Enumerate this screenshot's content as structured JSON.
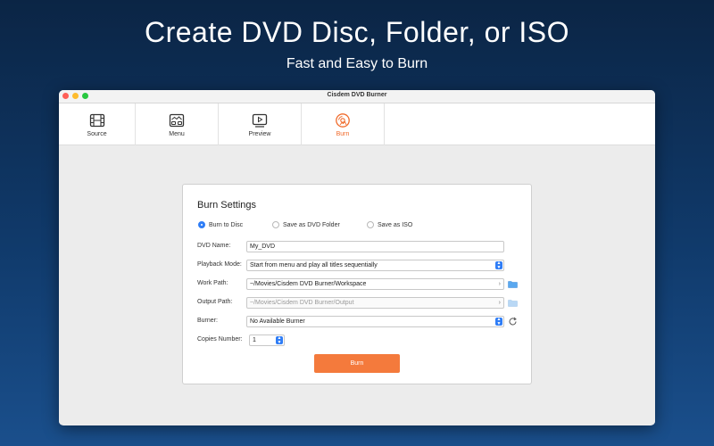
{
  "hero": {
    "title": "Create DVD Disc, Folder, or ISO",
    "subtitle": "Fast and Easy to Burn"
  },
  "window": {
    "title": "Cisdem DVD Burner"
  },
  "toolbar": {
    "tabs": [
      {
        "label": "Source",
        "icon": "film-icon",
        "active": false
      },
      {
        "label": "Menu",
        "icon": "menu-layout-icon",
        "active": false
      },
      {
        "label": "Preview",
        "icon": "play-icon",
        "active": false
      },
      {
        "label": "Burn",
        "icon": "disc-icon",
        "active": true
      }
    ]
  },
  "burn_settings": {
    "title": "Burn Settings",
    "options": [
      {
        "label": "Burn to Disc",
        "selected": true
      },
      {
        "label": "Save as DVD Folder",
        "selected": false
      },
      {
        "label": "Save as ISO",
        "selected": false
      }
    ],
    "dvd_name": {
      "label": "DVD Name:",
      "value": "My_DVD"
    },
    "playback_mode": {
      "label": "Playback Mode:",
      "value": "Start from menu and play all titles sequentially"
    },
    "work_path": {
      "label": "Work Path:",
      "value": "~/Movies/Cisdem DVD Burner/Workspace"
    },
    "output_path": {
      "label": "Output Path:",
      "value": "~/Movies/Cisdem DVD Burner/Output"
    },
    "burner": {
      "label": "Burner:",
      "value": "No Available Burner"
    },
    "copies": {
      "label": "Copies Number:",
      "value": "1"
    },
    "burn_button": "Burn"
  },
  "colors": {
    "accent": "#f47a3c",
    "select_blue": "#2f7df6",
    "background_top": "#0b2545",
    "background_bottom": "#1a4f8c"
  }
}
